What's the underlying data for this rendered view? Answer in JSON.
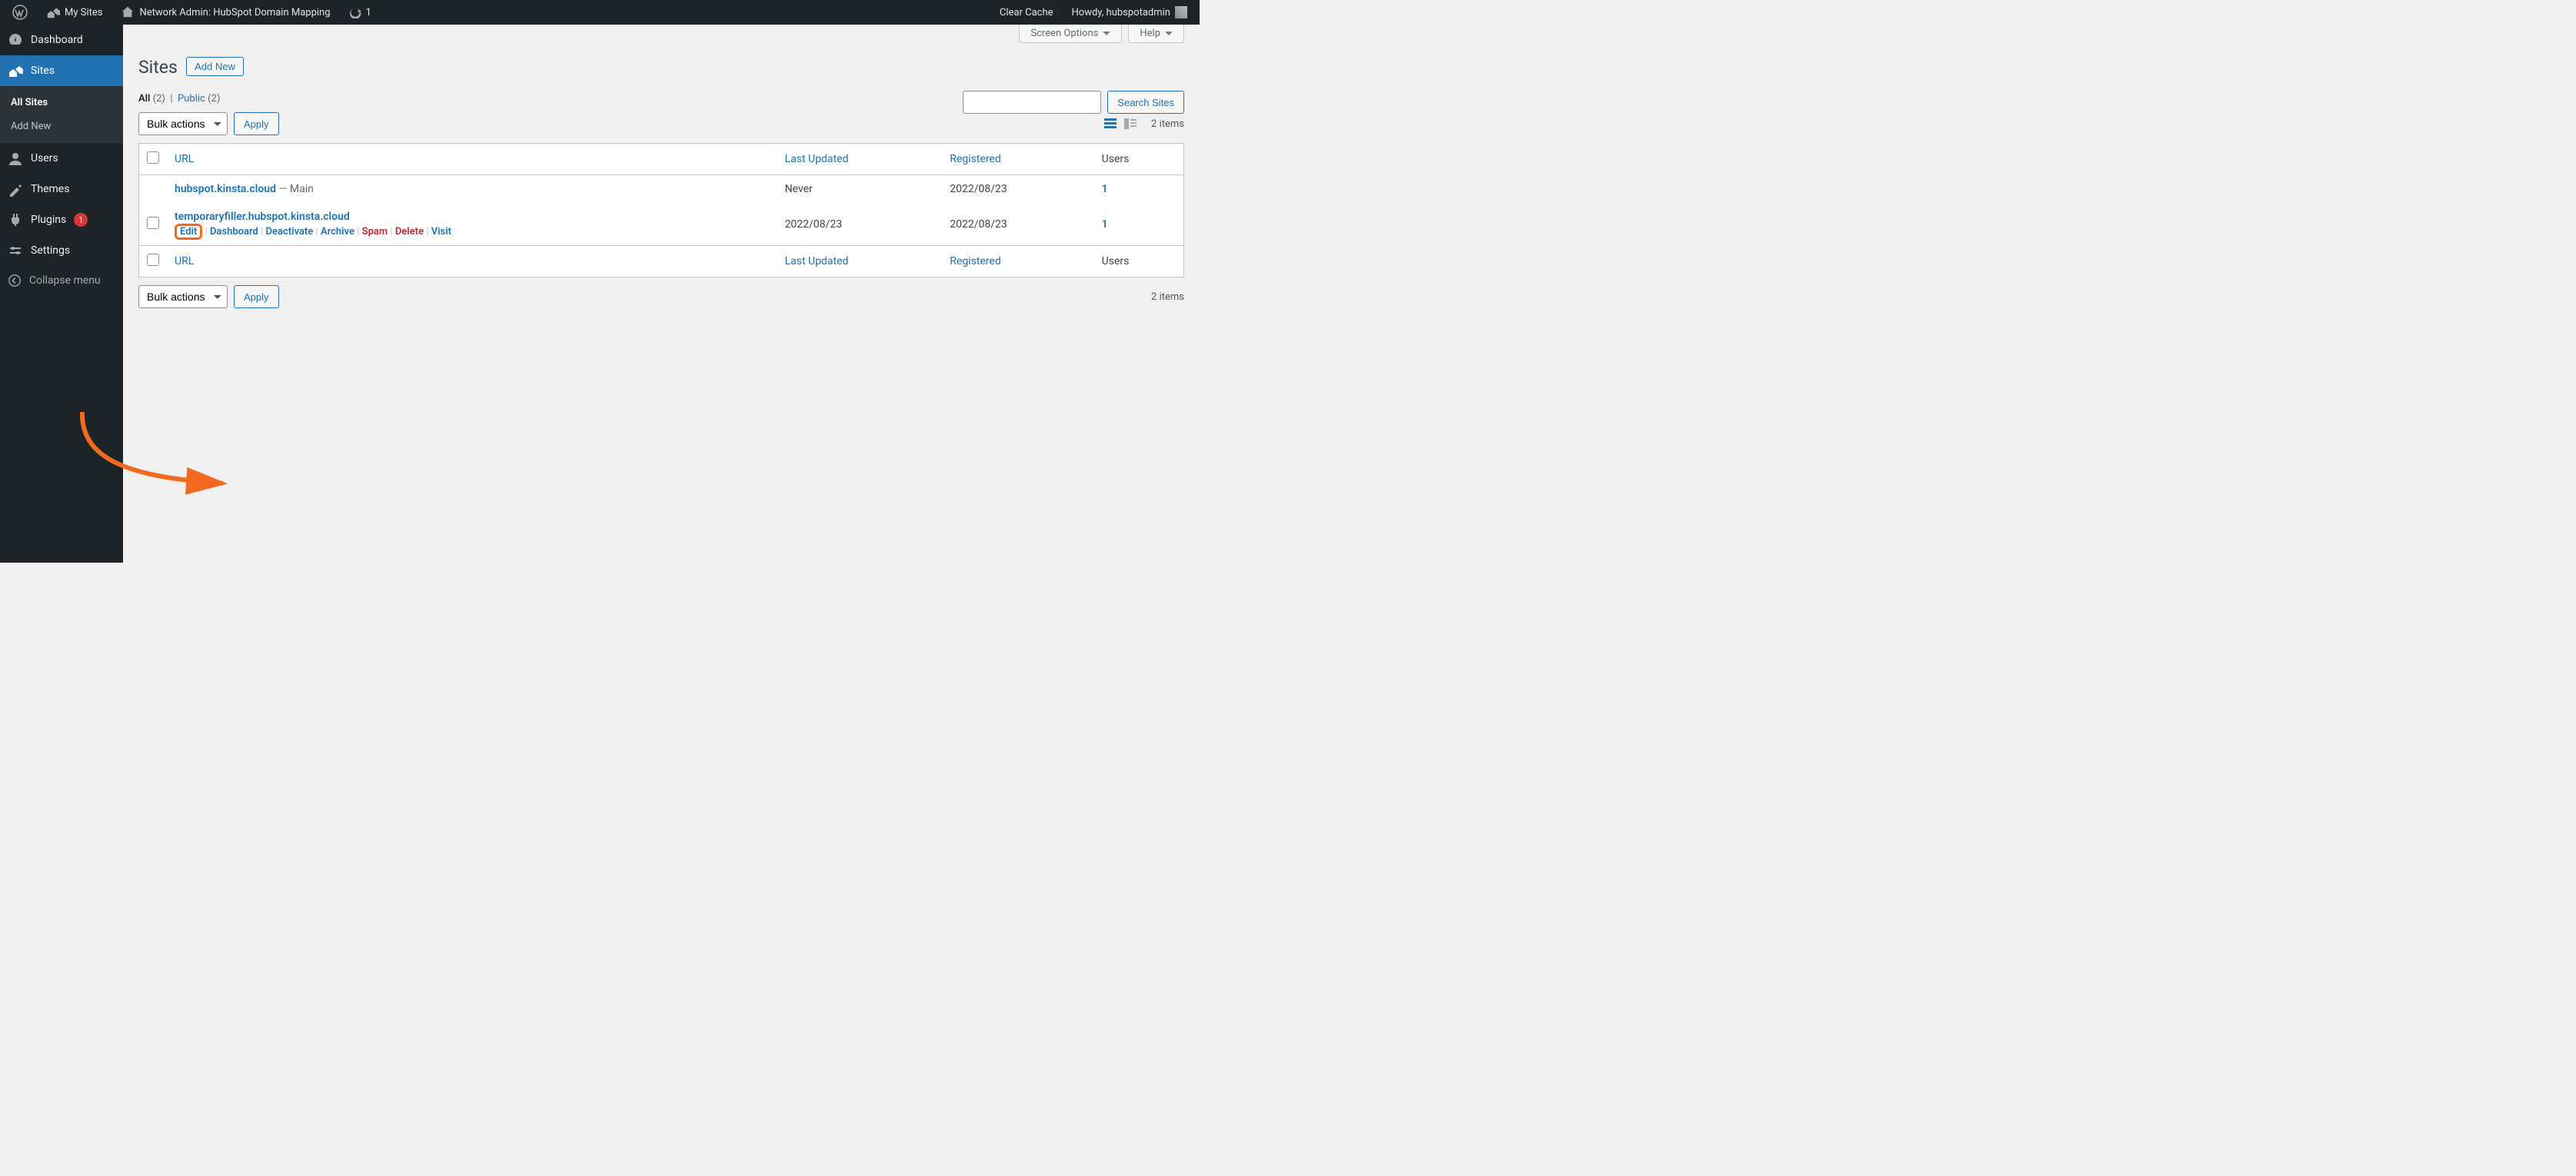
{
  "adminbar": {
    "my_sites": "My Sites",
    "network_admin": "Network Admin: HubSpot Domain Mapping",
    "updates_count": "1",
    "clear_cache": "Clear Cache",
    "howdy": "Howdy, hubspotadmin"
  },
  "sidebar": {
    "dashboard": "Dashboard",
    "sites": "Sites",
    "all_sites": "All Sites",
    "add_new": "Add New",
    "users": "Users",
    "themes": "Themes",
    "plugins": "Plugins",
    "plugins_count": "1",
    "settings": "Settings",
    "collapse": "Collapse menu"
  },
  "screen_meta": {
    "screen_options": "Screen Options",
    "help": "Help"
  },
  "heading": {
    "title": "Sites",
    "add_new": "Add New"
  },
  "filters": {
    "all_label": "All",
    "all_count": "(2)",
    "public_label": "Public",
    "public_count": "(2)"
  },
  "search": {
    "placeholder": "",
    "button": "Search Sites"
  },
  "bulk": {
    "label": "Bulk actions",
    "apply": "Apply"
  },
  "view": {
    "items": "2 items"
  },
  "columns": {
    "url": "URL",
    "last_updated": "Last Updated",
    "registered": "Registered",
    "users": "Users"
  },
  "rows": [
    {
      "url": "hubspot.kinsta.cloud",
      "main": " — Main",
      "last_updated": "Never",
      "registered": "2022/08/23",
      "users": "1"
    },
    {
      "url": "temporaryfiller.hubspot.kinsta.cloud",
      "main": "",
      "last_updated": "2022/08/23",
      "registered": "2022/08/23",
      "users": "1"
    }
  ],
  "row_actions": {
    "edit": "Edit",
    "dashboard": "Dashboard",
    "deactivate": "Deactivate",
    "archive": "Archive",
    "spam": "Spam",
    "delete": "Delete",
    "visit": "Visit"
  }
}
